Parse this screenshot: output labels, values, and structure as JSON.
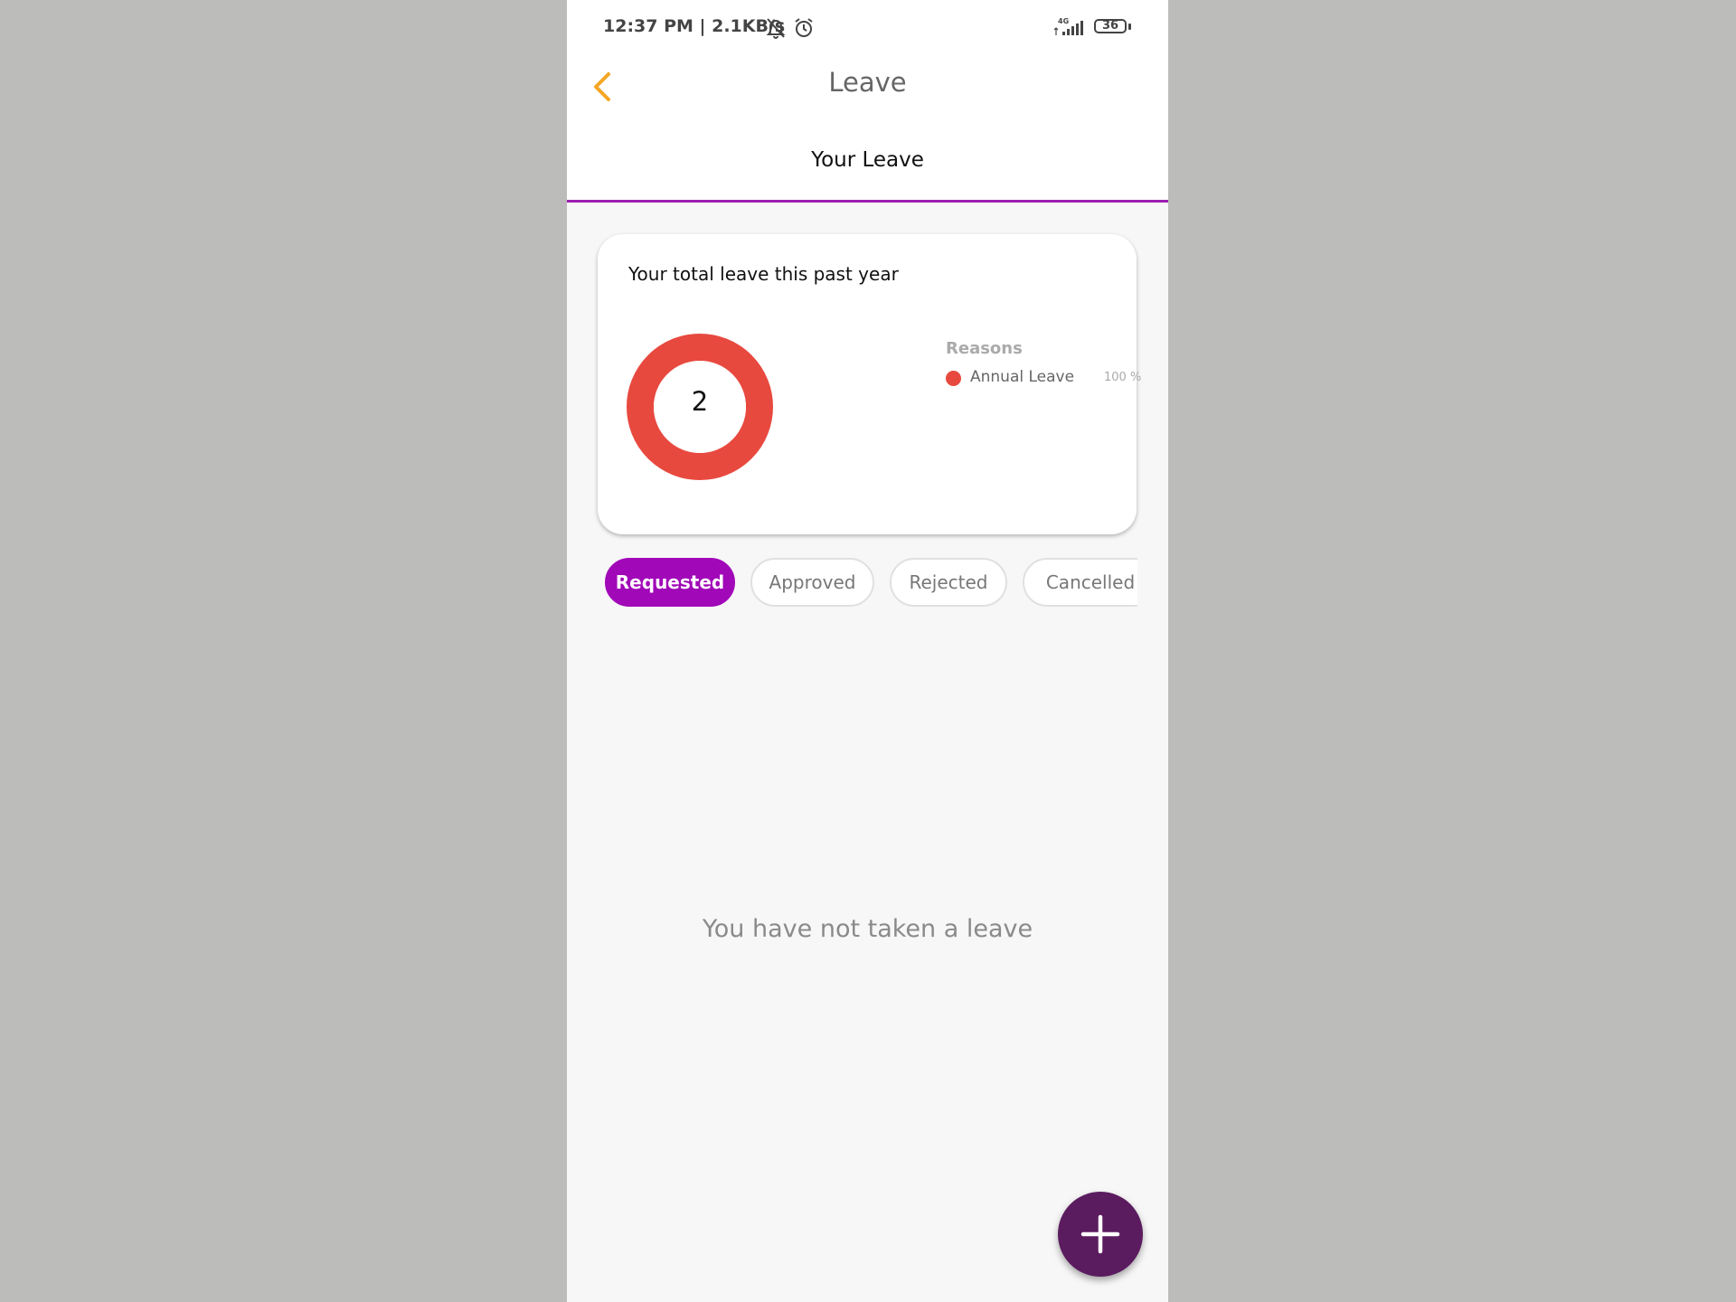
{
  "status_bar": {
    "time": "12:37 PM | 2.1KB/s",
    "network": "4G",
    "battery": "36"
  },
  "header": {
    "title": "Leave",
    "back_icon": "chevron-left-icon"
  },
  "tabs": [
    {
      "label": "Your Leave",
      "active": true
    }
  ],
  "summary_card": {
    "title": "Your total leave this past year",
    "total": "2",
    "legend_title": "Reasons",
    "legend": [
      {
        "label": "Annual Leave",
        "percent": "100 %",
        "color": "#e8493f"
      }
    ]
  },
  "chart_data": {
    "type": "pie",
    "categories": [
      "Annual Leave"
    ],
    "values": [
      100
    ],
    "center_label": "2",
    "legend_title": "Reasons",
    "colors": [
      "#e8493f"
    ]
  },
  "filters": [
    {
      "label": "Requested",
      "active": true
    },
    {
      "label": "Approved",
      "active": false
    },
    {
      "label": "Rejected",
      "active": false
    },
    {
      "label": "Cancelled",
      "active": false
    }
  ],
  "empty_state": {
    "message": "You have not taken a leave"
  },
  "fab": {
    "icon": "plus-icon",
    "color": "#5b1b5f"
  },
  "colors": {
    "accent": "#a108b8",
    "tab_underline": "#9b1fb0",
    "back_icon": "#f5a623",
    "donut": "#e8493f"
  }
}
